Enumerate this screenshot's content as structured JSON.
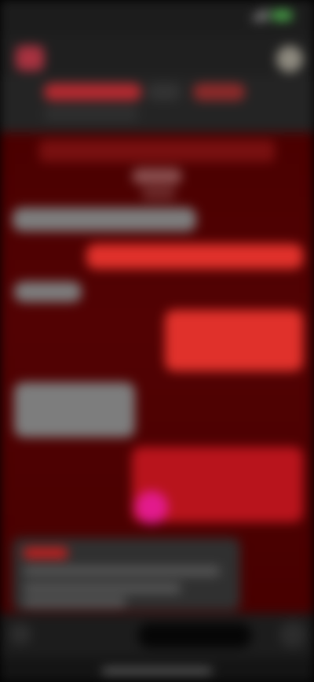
{
  "status_bar": {
    "time": "",
    "signal_icon": "signal-bars-icon",
    "battery_icon": "battery-icon",
    "battery_color": "#4aa84a"
  },
  "header": {
    "title": "",
    "subtitle": "",
    "back_icon": "back-icon",
    "avatar_icon": "avatar-icon"
  },
  "tabs": [
    {
      "label": ""
    },
    {
      "label": ""
    },
    {
      "label": ""
    }
  ],
  "chat": {
    "background_color": "#4a0000",
    "banner_text": "",
    "date_label": "",
    "messages": [
      {
        "direction": "in",
        "text": ""
      },
      {
        "direction": "out",
        "text": ""
      },
      {
        "direction": "in",
        "text": ""
      },
      {
        "direction": "out",
        "text": ""
      },
      {
        "direction": "in",
        "text": ""
      },
      {
        "direction": "out",
        "text": ""
      },
      {
        "direction": "in",
        "text": ""
      }
    ],
    "sticker_icon": "sticker-icon"
  },
  "composer": {
    "placeholder": "",
    "attach_icon": "plus-icon",
    "send_icon": "mic-icon"
  },
  "colors": {
    "accent": "#e0312b",
    "outgoing_bubble": "#e0312b",
    "incoming_bubble": "#7d7d7d"
  }
}
